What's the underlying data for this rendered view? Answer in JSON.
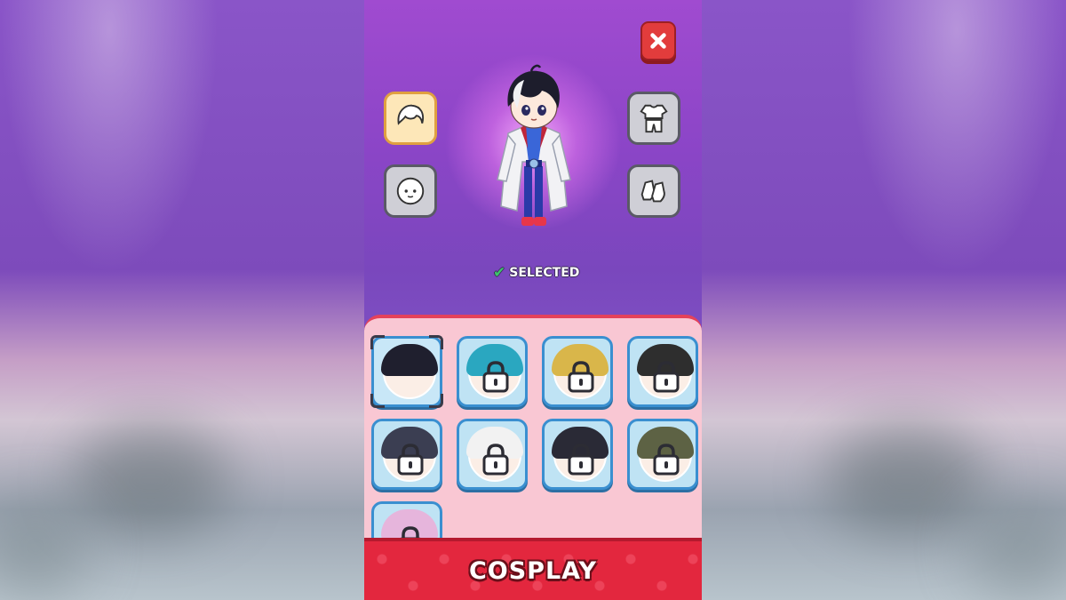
{
  "header": {
    "close_icon": "close-icon",
    "accent_color": "#e23c3c"
  },
  "category_buttons": [
    {
      "name": "hair",
      "icon": "hair-icon",
      "active": true
    },
    {
      "name": "face",
      "icon": "face-icon",
      "active": false
    },
    {
      "name": "outfit",
      "icon": "shirt-icon",
      "active": false
    },
    {
      "name": "shoes",
      "icon": "shoes-icon",
      "active": false
    }
  ],
  "preview": {
    "status_label": "SELECTED",
    "status_icon": "checkmark-icon"
  },
  "hair_grid": [
    {
      "hair_color": "#1f1f2e",
      "locked": false,
      "selected": true
    },
    {
      "hair_color": "#2aa7c0",
      "locked": true,
      "selected": false
    },
    {
      "hair_color": "#d9b64a",
      "locked": true,
      "selected": false
    },
    {
      "hair_color": "#2e2e2e",
      "locked": true,
      "selected": false
    },
    {
      "hair_color": "#3b3e52",
      "locked": true,
      "selected": false
    },
    {
      "hair_color": "#f2f2f2",
      "locked": true,
      "selected": false
    },
    {
      "hair_color": "#2a2a36",
      "locked": true,
      "selected": false
    },
    {
      "hair_color": "#5d6244",
      "locked": true,
      "selected": false
    },
    {
      "hair_color": "#e6b5dc",
      "locked": true,
      "selected": false
    }
  ],
  "footer": {
    "title": "COSPLAY"
  }
}
